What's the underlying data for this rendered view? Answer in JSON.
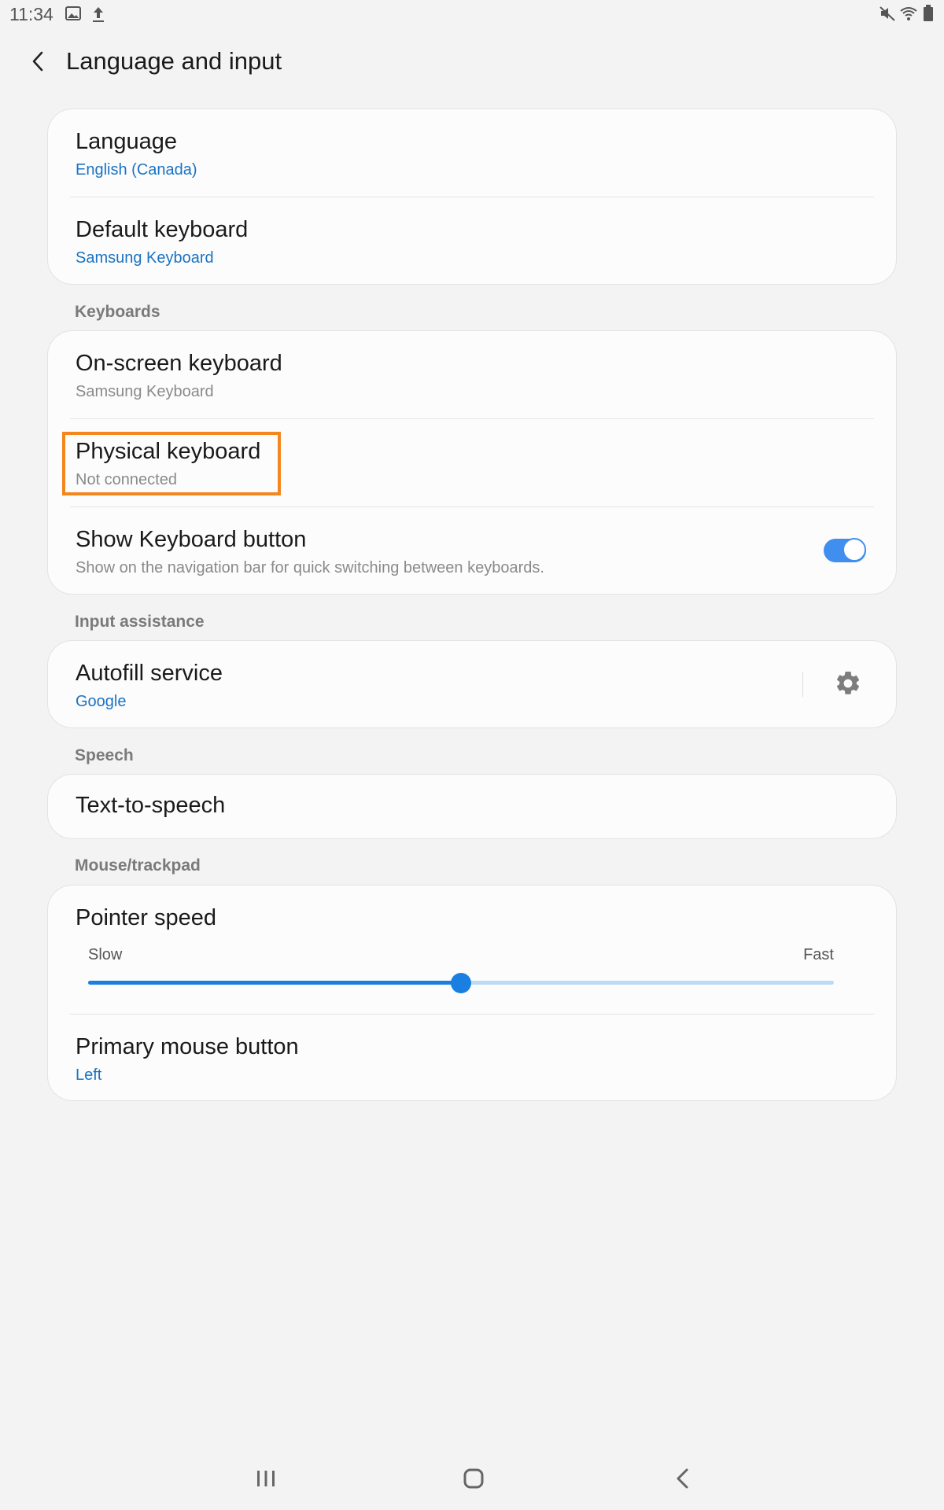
{
  "status_bar": {
    "time": "11:34",
    "icons_left": [
      "image-icon",
      "upload-icon"
    ],
    "icons_right": [
      "mute-icon",
      "wifi-icon",
      "battery-icon"
    ]
  },
  "header": {
    "title": "Language and input",
    "back_icon": "chevron-left-icon"
  },
  "groups": {
    "general": {
      "language": {
        "title": "Language",
        "value": "English (Canada)"
      },
      "default_keyboard": {
        "title": "Default keyboard",
        "value": "Samsung Keyboard"
      }
    },
    "keyboards": {
      "label": "Keyboards",
      "onscreen": {
        "title": "On-screen keyboard",
        "value": "Samsung Keyboard"
      },
      "physical": {
        "title": "Physical keyboard",
        "value": "Not connected"
      },
      "show_button": {
        "title": "Show Keyboard button",
        "value": "Show on the navigation bar for quick switching between keyboards.",
        "enabled": true
      }
    },
    "input_assistance": {
      "label": "Input assistance",
      "autofill": {
        "title": "Autofill service",
        "value": "Google",
        "settings_icon": "gear-icon"
      }
    },
    "speech": {
      "label": "Speech",
      "tts": {
        "title": "Text-to-speech"
      }
    },
    "mouse": {
      "label": "Mouse/trackpad",
      "pointer_speed": {
        "title": "Pointer speed",
        "min_label": "Slow",
        "max_label": "Fast",
        "level": 0.5
      },
      "primary_button": {
        "title": "Primary mouse button",
        "value": "Left"
      }
    }
  },
  "nav_bar": {
    "icons": [
      "recents-icon",
      "home-icon",
      "back-icon"
    ]
  },
  "colors": {
    "accent": "#1a73c4",
    "toggle": "#3f8ef0",
    "highlight": "#f4861e"
  }
}
